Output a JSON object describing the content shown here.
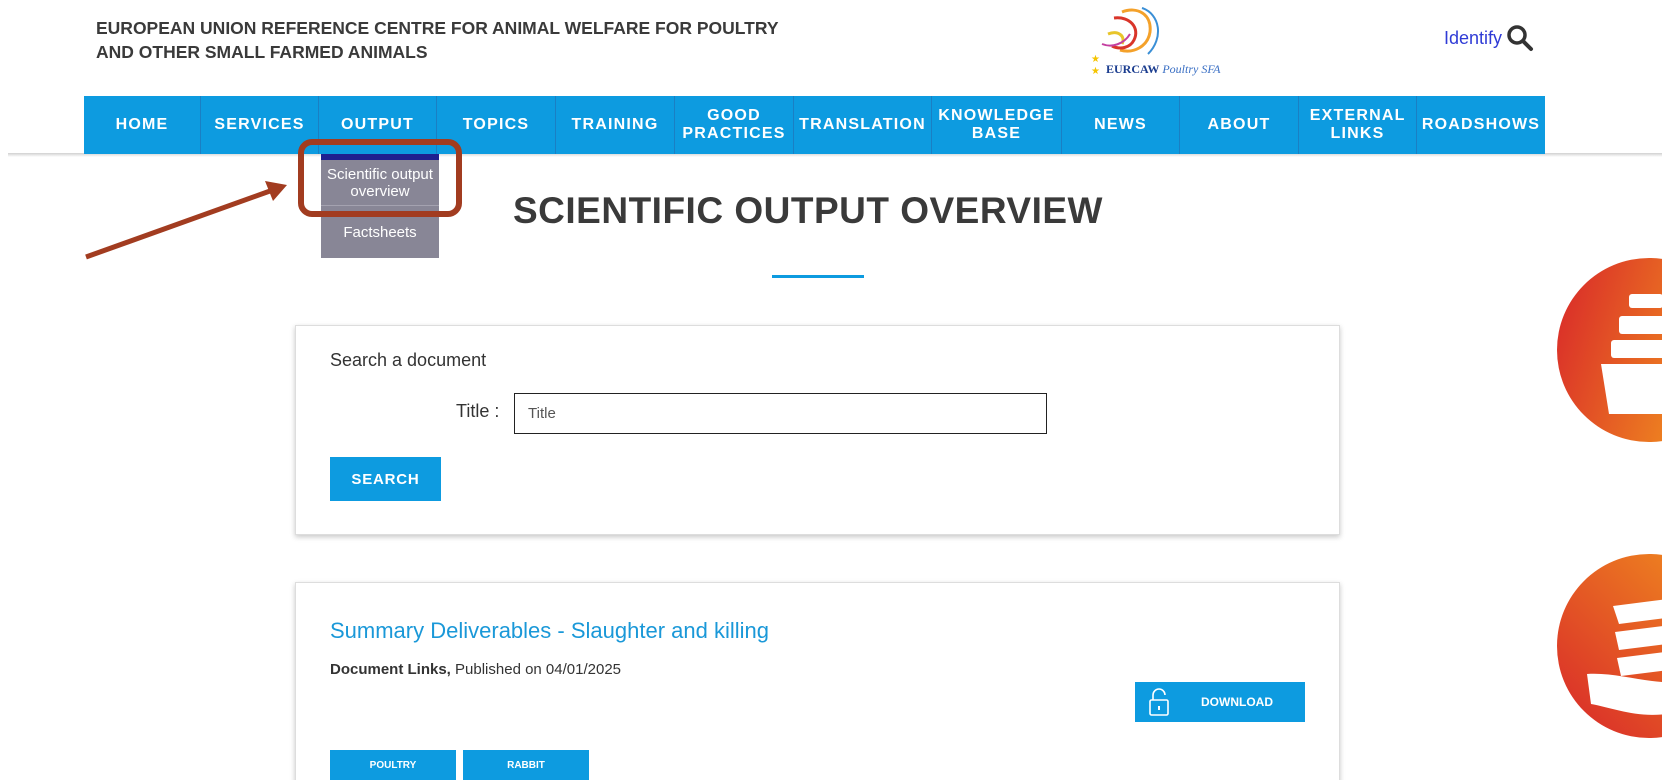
{
  "header": {
    "title_line1": "EUROPEAN UNION REFERENCE CENTRE FOR ANIMAL WELFARE FOR POULTRY",
    "title_line2": "AND OTHER SMALL FARMED ANIMALS",
    "logo_text_bold": "EURCAW",
    "logo_text_italic": "Poultry SFA",
    "identify_label": "Identify",
    "search_icon": "search-icon"
  },
  "nav": {
    "items": [
      {
        "label": "HOME"
      },
      {
        "label": "SERVICES"
      },
      {
        "label": "OUTPUT"
      },
      {
        "label": "TOPICS"
      },
      {
        "label": "TRAINING"
      },
      {
        "label": "GOOD PRACTICES"
      },
      {
        "label": "TRANSLATION"
      },
      {
        "label": "KNOWLEDGE BASE"
      },
      {
        "label": "NEWS"
      },
      {
        "label": "ABOUT"
      },
      {
        "label": "EXTERNAL LINKS"
      },
      {
        "label": "ROADSHOWS"
      }
    ],
    "color": "#0d9be0"
  },
  "dropdown": {
    "items": [
      {
        "label": "Scientific output overview"
      },
      {
        "label": "Factsheets"
      }
    ],
    "highlight_color": "#a23c20"
  },
  "page": {
    "heading": "SCIENTIFIC OUTPUT OVERVIEW"
  },
  "search": {
    "label": "Search a document",
    "title_label": "Title :",
    "title_placeholder": "Title",
    "button_label": "SEARCH"
  },
  "results": [
    {
      "title": "Summary Deliverables - Slaughter and killing",
      "doc_type": "Document Links,",
      "published": "Published on 04/01/2025",
      "download_label": "DOWNLOAD",
      "tags": [
        "POULTRY",
        "RABBIT"
      ]
    }
  ],
  "side_icons": [
    "folder-icon",
    "hand-documents-icon"
  ]
}
